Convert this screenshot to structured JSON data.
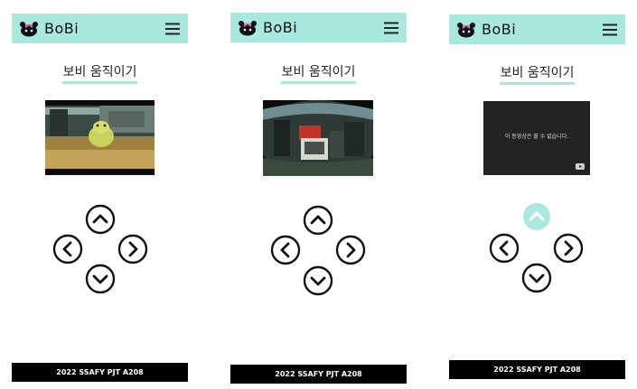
{
  "screens": [
    {
      "brand": "BoBi",
      "title": "보비 움직이기",
      "footer": "2022 SSAFY PJT A208",
      "video_state": "robot-camera-view"
    },
    {
      "brand": "BoBi",
      "title": "보비 움직이기",
      "footer": "2022 SSAFY PJT A208",
      "video_state": "fisheye-desk-view"
    },
    {
      "brand": "BoBi",
      "title": "보비 움직이기",
      "footer": "2022 SSAFY PJT A208",
      "video_state": "unavailable",
      "video_message": "이 동영상은 볼 수 없습니다.",
      "active_control": "up"
    }
  ],
  "colors": {
    "header_bg": "#a8e8de",
    "accent": "#a8e8de",
    "footer_bg": "#000000"
  },
  "icons": [
    "bobi-logo-icon",
    "hamburger-menu-icon",
    "arrow-up-icon",
    "arrow-left-icon",
    "arrow-right-icon",
    "arrow-down-icon",
    "youtube-icon"
  ]
}
